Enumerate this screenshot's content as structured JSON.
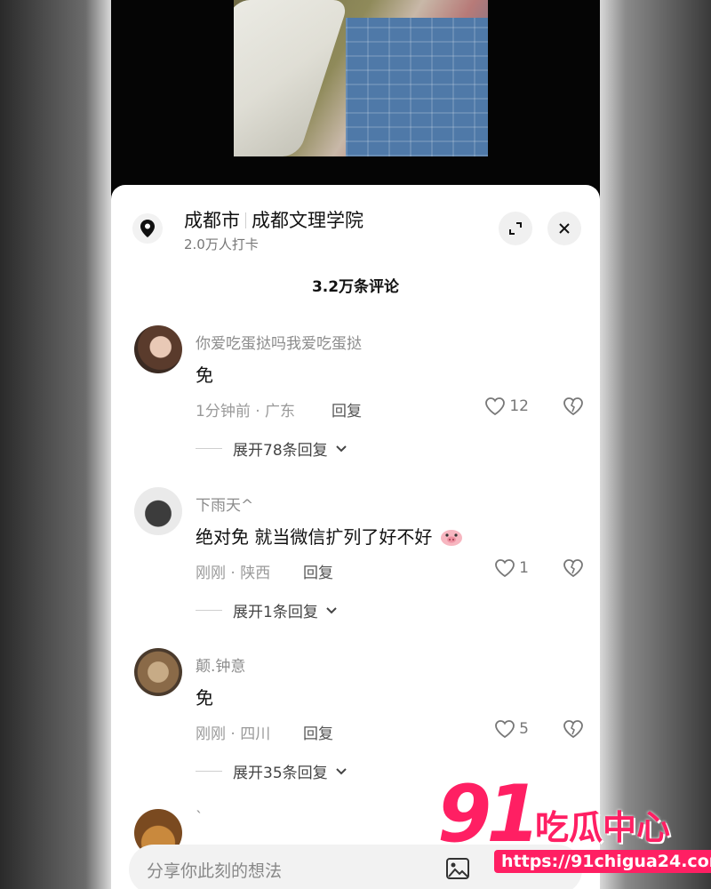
{
  "location": {
    "city": "成都市",
    "place": "成都文理学院",
    "checkins": "2.0万人打卡"
  },
  "comments_title": "3.2万条评论",
  "comments": [
    {
      "user": "你爱吃蛋挞吗我爱吃蛋挞",
      "text": "免",
      "time_region": "1分钟前 · 广东",
      "reply": "回复",
      "likes": "12",
      "expand": "展开78条回复"
    },
    {
      "user": "下雨天^",
      "text": "绝对免 就当微信扩列了好不好",
      "time_region": "刚刚 · 陕西",
      "reply": "回复",
      "likes": "1",
      "expand": "展开1条回复"
    },
    {
      "user": "颠.钟意",
      "text": "免",
      "time_region": "刚刚 · 四川",
      "reply": "回复",
      "likes": "5",
      "expand": "展开35条回复"
    },
    {
      "user": "`"
    }
  ],
  "input": {
    "placeholder": "分享你此刻的想法"
  },
  "watermark": {
    "number": "91",
    "brand": "吃瓜中心",
    "url": "https://91chigua24.com"
  },
  "colors": {
    "accent": "#ff1f63",
    "sheet": "#ffffff"
  }
}
